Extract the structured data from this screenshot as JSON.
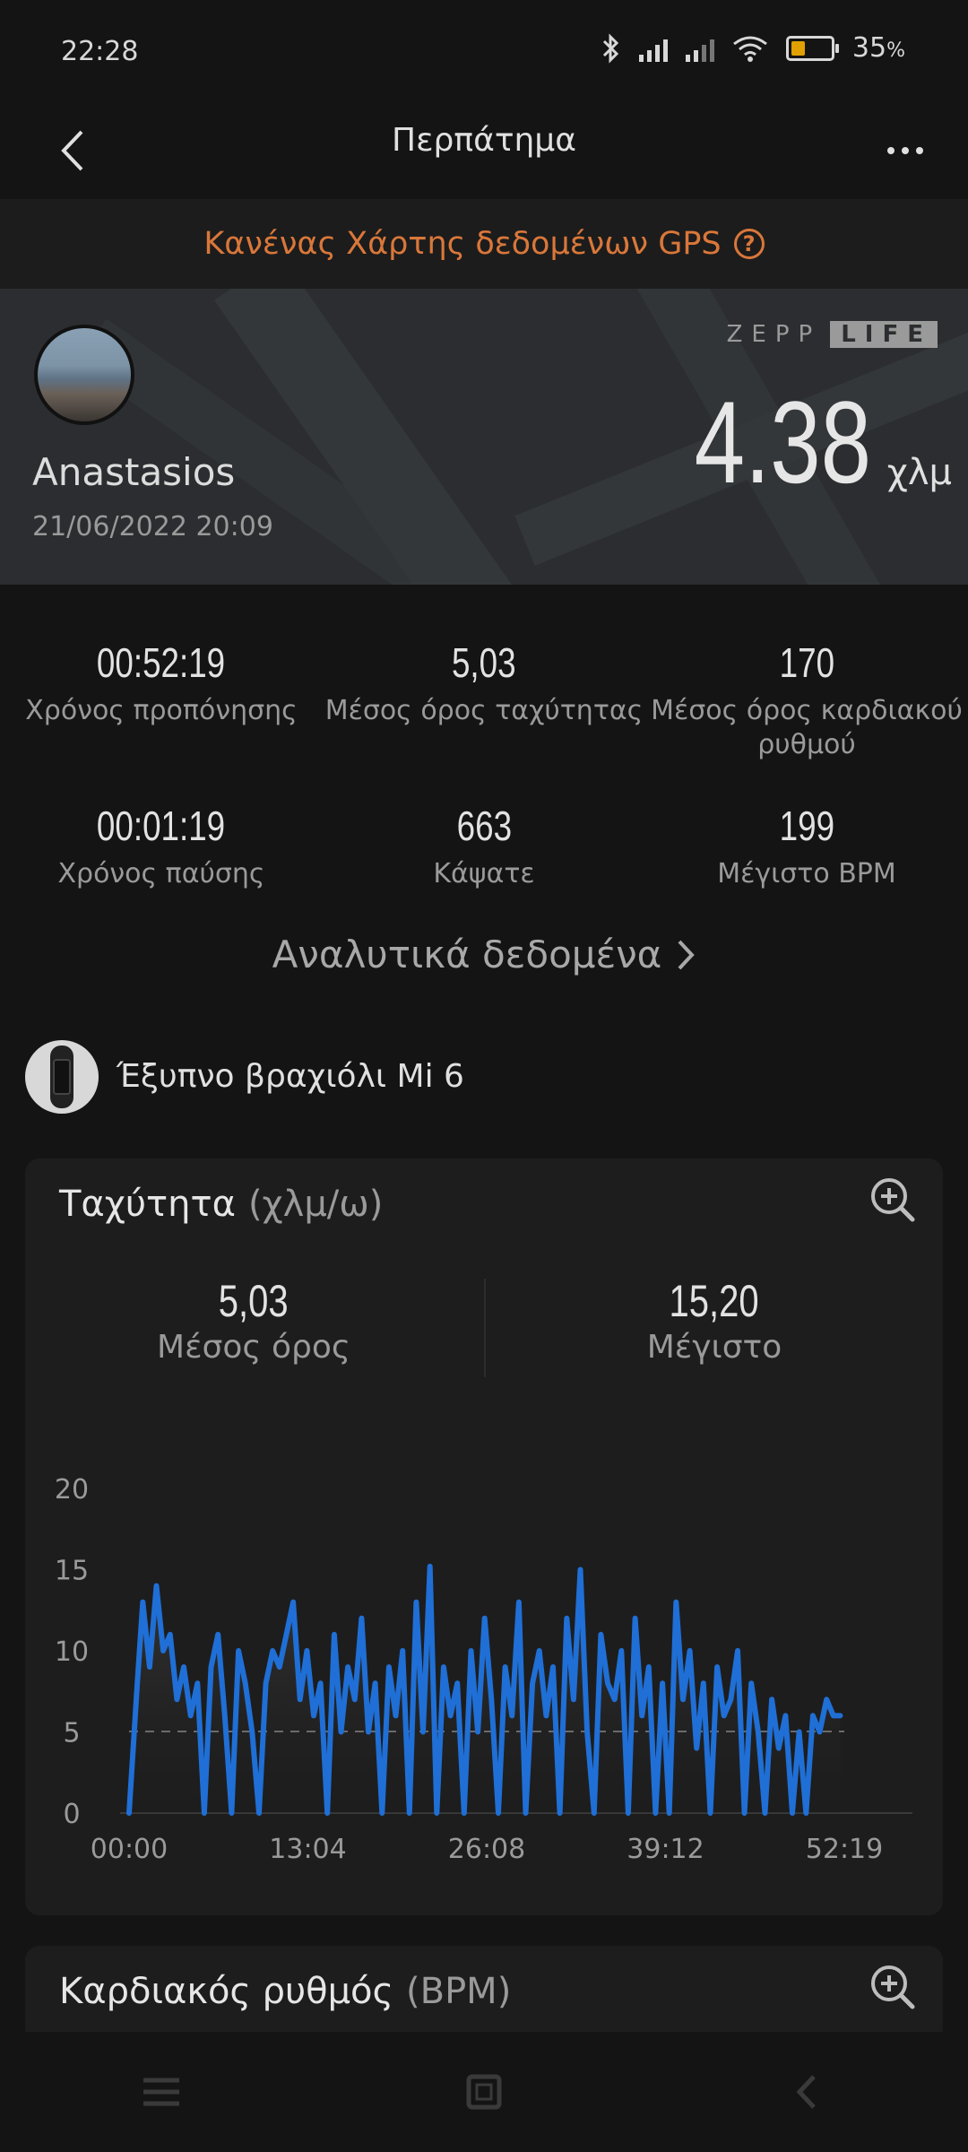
{
  "status_bar": {
    "time": "22:28",
    "battery": "35",
    "battery_unit": "%",
    "battery_level": 0.35
  },
  "header": {
    "title": "Περπάτημα",
    "back_icon": "back-arrow-icon",
    "more_icon": "more-dots-icon"
  },
  "gps_banner": {
    "text": "Κανένας Χάρτης δεδομένων GPS"
  },
  "map_card": {
    "user_name": "Anastasios",
    "date": "21/06/2022 20:09",
    "brand": {
      "zepp": "ZEPP",
      "life": "LIFE"
    },
    "distance": "4.38",
    "distance_unit": "χλμ"
  },
  "stats": [
    {
      "value": "00:52:19",
      "label": "Χρόνος προπόνησης"
    },
    {
      "value": "5,03",
      "label": "Μέσος όρος ταχύτητας"
    },
    {
      "value": "170",
      "label": "Μέσος όρος καρδιακού ρυθμού"
    },
    {
      "value": "00:01:19",
      "label": "Χρόνος παύσης"
    },
    {
      "value": "663",
      "label": "Κάψατε"
    },
    {
      "value": "199",
      "label": "Μέγιστο BPM"
    }
  ],
  "details_link": {
    "label": "Αναλυτικά δεδομένα"
  },
  "device": {
    "name": "Έξυπνο βραχιόλι Mi 6"
  },
  "speed_card": {
    "title": "Ταχύτητα",
    "unit": "(χλμ/ω)",
    "avg_value": "5,03",
    "avg_label": "Μέσος όρος",
    "max_value": "15,20",
    "max_label": "Μέγιστο"
  },
  "chart_data": {
    "type": "line",
    "title": "",
    "xlabel": "",
    "ylabel": "",
    "x_tick_labels": [
      "00:00",
      "13:04",
      "26:08",
      "39:12",
      "52:19"
    ],
    "y_ticks": [
      0,
      5,
      10,
      15,
      20
    ],
    "ylim": [
      0,
      20
    ],
    "xlim": [
      0,
      52.3
    ],
    "average_line": 5.03,
    "grid": false,
    "line_color": "#1f6fd6",
    "x": [
      0,
      0.6,
      1,
      1.5,
      2,
      2.5,
      3,
      3.5,
      4,
      4.5,
      5,
      5.5,
      6,
      6.5,
      7,
      7.5,
      8,
      8.5,
      9,
      9.5,
      10,
      10.5,
      11,
      11.5,
      12,
      12.5,
      13,
      13.5,
      14,
      14.5,
      15,
      15.5,
      16,
      16.5,
      17,
      17.5,
      18,
      18.5,
      19,
      19.5,
      20,
      20.5,
      21,
      21.5,
      22,
      22.5,
      23,
      23.5,
      24,
      24.5,
      25,
      25.5,
      26,
      26.5,
      27,
      27.5,
      28,
      28.5,
      29,
      29.5,
      30,
      30.5,
      31,
      31.5,
      32,
      32.5,
      33,
      33.5,
      34,
      34.5,
      35,
      35.5,
      36,
      36.5,
      37,
      37.5,
      38,
      38.5,
      39,
      39.5,
      40,
      40.5,
      41,
      41.5,
      42,
      42.5,
      43,
      43.5,
      44,
      44.5,
      45,
      45.5,
      46,
      46.5,
      47,
      47.5,
      48,
      48.5,
      49,
      49.5,
      50,
      50.5,
      51,
      51.5,
      52
    ],
    "values": [
      0,
      8,
      13,
      9,
      14,
      10,
      11,
      7,
      9,
      6,
      8,
      0,
      9,
      11,
      6,
      0,
      10,
      8,
      5,
      0,
      8,
      10,
      9,
      11,
      13,
      7,
      10,
      6,
      8,
      0,
      11,
      5,
      9,
      7,
      12,
      5,
      8,
      0,
      9,
      6,
      10,
      0,
      13,
      5,
      15.2,
      0,
      9,
      6,
      8,
      0,
      10,
      5,
      12,
      7,
      0,
      9,
      6,
      13,
      0,
      8,
      10,
      6,
      9,
      0,
      12,
      7,
      15,
      5,
      0,
      11,
      8,
      7,
      10,
      0,
      12,
      6,
      9,
      0,
      8,
      0,
      13,
      7,
      10,
      4,
      8,
      0,
      9,
      6,
      7,
      10,
      0,
      8,
      5,
      0,
      7,
      4,
      6,
      0,
      5,
      0,
      6,
      5,
      7,
      6,
      6
    ]
  },
  "hr_card": {
    "title": "Καρδιακός ρυθμός",
    "unit": "(BPM)"
  }
}
